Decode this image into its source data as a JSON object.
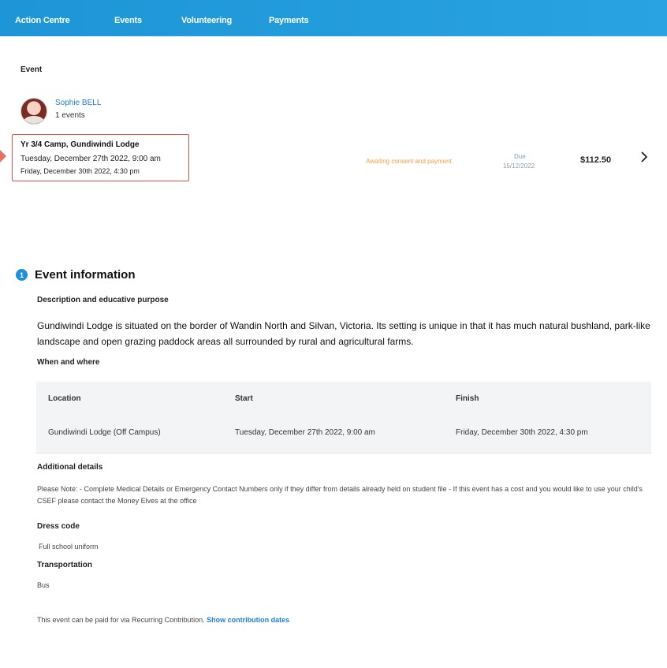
{
  "nav": {
    "items": [
      {
        "label": "Action Centre"
      },
      {
        "label": "Events"
      },
      {
        "label": "Volunteering"
      },
      {
        "label": "Payments"
      }
    ]
  },
  "header": {
    "section_label": "Event",
    "student_name": "Sophie BELL",
    "events_count": "1 events"
  },
  "event_row": {
    "title": "Yr 3/4 Camp, Gundiwindi Lodge",
    "start": "Tuesday, December 27th 2022, 9:00 am",
    "end": "Friday, December 30th 2022, 4:30 pm",
    "status": "Awaiting consent and payment",
    "due_label": "Due",
    "due_date": "15/12/2022",
    "amount": "$112.50",
    "status_color": "#f0a14a"
  },
  "info": {
    "step_number": "1",
    "title": "Event information",
    "description_heading": "Description and educative purpose",
    "description": "Gundiwindi Lodge is situated on the border of Wandin North and Silvan, Victoria. Its setting is unique in that it has much natural bushland, park-like landscape and open grazing paddock areas all surrounded by rural and agricultural farms.",
    "when_where_heading": "When and where",
    "table": {
      "headers": [
        "Location",
        "Start",
        "Finish"
      ],
      "row": [
        "Gundiwindi Lodge (Off Campus)",
        "Tuesday, December 27th 2022, 9:00 am",
        "Friday, December 30th 2022, 4:30 pm"
      ]
    },
    "additional_heading": "Additional details",
    "additional_text": "Please Note: - Complete Medical Details or Emergency Contact Numbers only if they differ from details already held on student file - If this event has a cost and you would like to use your child's CSEF please contact the Money Elves at the office",
    "dress_heading": "Dress code",
    "dress_text": "Full school uniform",
    "transport_heading": "Transportation",
    "transport_text": "Bus",
    "contribution_text": "This event can be paid for via Recurring Contribution.",
    "contribution_link": "Show contribution dates"
  },
  "colors": {
    "nav_bar": "#1d95d6",
    "accent": "#1d8fe0",
    "highlight_border": "#e05050"
  }
}
